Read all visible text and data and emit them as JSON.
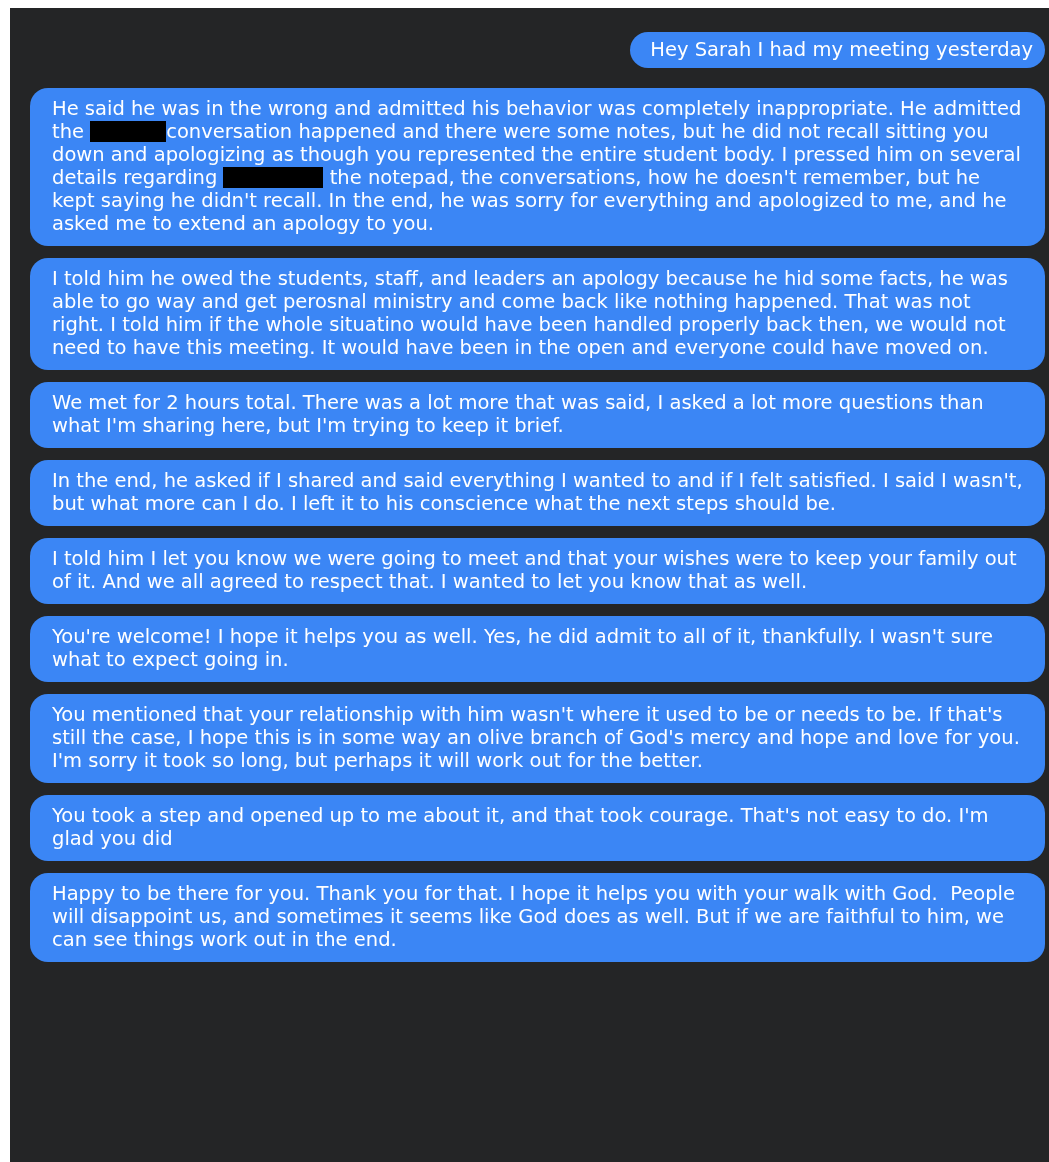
{
  "messages": [
    {
      "outgoing": true,
      "parts": [
        {
          "kind": "text",
          "text": "Hey Sarah I had my meeting yesterday"
        }
      ]
    },
    {
      "outgoing": false,
      "parts": [
        {
          "kind": "text",
          "text": "He said he was in the wrong and admitted his behavior was completely inappropriate. He admitted the "
        },
        {
          "kind": "redaction"
        },
        {
          "kind": "text",
          "text": "conversation happened and there were some notes, but he did not recall sitting you down and apologizing as though you represented the entire student body. I pressed him on several details regarding "
        },
        {
          "kind": "redaction"
        },
        {
          "kind": "text",
          "text": " the notepad, the conversations, how he doesn't remember, but he kept saying he didn't recall. In the end, he was sorry for everything and apologized to me, and he asked me to extend an apology to you."
        }
      ]
    },
    {
      "outgoing": false,
      "parts": [
        {
          "kind": "text",
          "text": "I told him he owed the students, staff, and leaders an apology because he hid some facts, he was able to go way and get perosnal ministry and come back like nothing happened. That was not right. I told him if the whole situatino would have been handled properly back then, we would not need to have this meeting. It would have been in the open and everyone could have moved on."
        }
      ]
    },
    {
      "outgoing": false,
      "parts": [
        {
          "kind": "text",
          "text": "We met for 2 hours total. There was a lot more that was said, I asked a lot more questions than what I'm sharing here, but I'm trying to keep it brief."
        }
      ]
    },
    {
      "outgoing": false,
      "parts": [
        {
          "kind": "text",
          "text": "In the end, he asked if I shared and said everything I wanted to and if I felt satisfied. I said I wasn't, but what more can I do. I left it to his conscience what the next steps should be."
        }
      ]
    },
    {
      "outgoing": false,
      "parts": [
        {
          "kind": "text",
          "text": "I told him I let you know we were going to meet and that your wishes were to keep your family out of it. And we all agreed to respect that. I wanted to let you know that as well."
        }
      ]
    },
    {
      "outgoing": false,
      "parts": [
        {
          "kind": "text",
          "text": "You're welcome! I hope it helps you as well. Yes, he did admit to all of it, thankfully. I wasn't sure what to expect going in."
        }
      ]
    },
    {
      "outgoing": false,
      "parts": [
        {
          "kind": "text",
          "text": "You mentioned that your relationship with him wasn't where it used to be or needs to be. If that's still the case, I hope this is in some way an olive branch of God's mercy and hope and love for you. I'm sorry it took so long, but perhaps it will work out for the better."
        }
      ]
    },
    {
      "outgoing": false,
      "parts": [
        {
          "kind": "text",
          "text": "You took a step and opened up to me about it, and that took courage. That's not easy to do. I'm glad you did"
        }
      ]
    },
    {
      "outgoing": false,
      "parts": [
        {
          "kind": "text",
          "text": "Happy to be there for you. Thank you for that. I hope it helps you with your walk with God.  People will disappoint us, and sometimes it seems like God does as well. But if we are faithful to him, we can see things work out in the end."
        }
      ]
    }
  ]
}
